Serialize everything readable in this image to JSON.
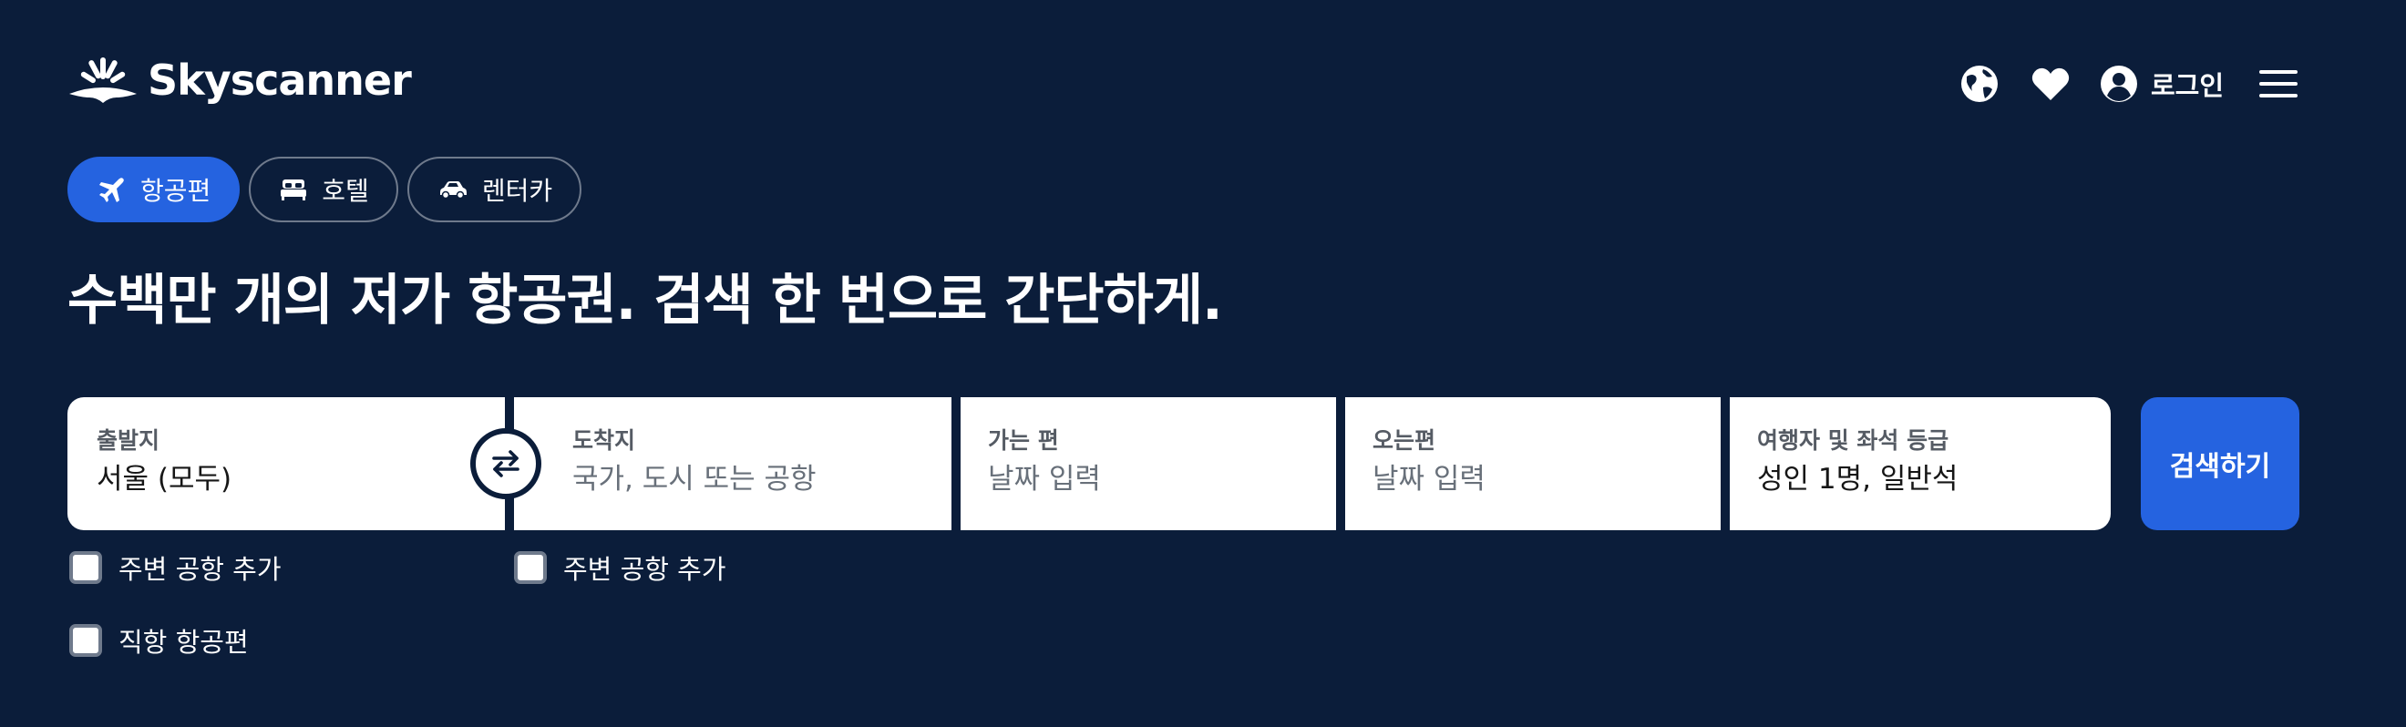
{
  "brand": {
    "name": "Skyscanner"
  },
  "header": {
    "globe_icon": "globe-icon",
    "heart_icon": "heart-icon",
    "login_label": "로그인",
    "menu_icon": "hamburger-menu-icon"
  },
  "tabs": [
    {
      "label": "항공편",
      "icon": "plane-icon",
      "active": true
    },
    {
      "label": "호텔",
      "icon": "bed-icon",
      "active": false
    },
    {
      "label": "렌터카",
      "icon": "car-icon",
      "active": false
    }
  ],
  "headline": "수백만 개의 저가 항공권. 검색 한 번으로 간단하게.",
  "search": {
    "origin": {
      "label": "출발지",
      "value": "서울 (모두)"
    },
    "destination": {
      "label": "도착지",
      "placeholder": "국가, 도시 또는 공항"
    },
    "depart": {
      "label": "가는 편",
      "placeholder": "날짜 입력"
    },
    "return": {
      "label": "오는편",
      "placeholder": "날짜 입력"
    },
    "travellers": {
      "label": "여행자 및 좌석 등급",
      "value": "성인 1명, 일반석"
    },
    "button_label": "검색하기"
  },
  "options": {
    "origin_nearby": "주변 공항 추가",
    "dest_nearby": "주변 공항 추가",
    "direct_only": "직항 항공편"
  },
  "colors": {
    "background": "#0b1d3a",
    "accent": "#2563e0",
    "field_bg": "#ffffff"
  }
}
